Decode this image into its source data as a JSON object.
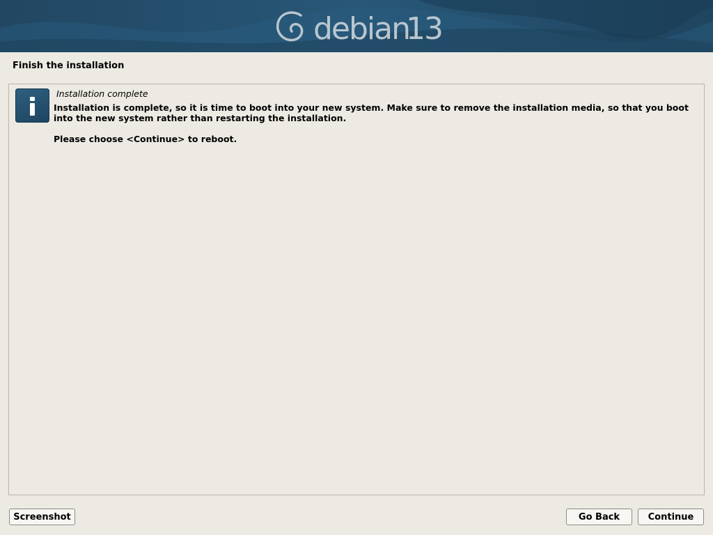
{
  "banner": {
    "logo_text": "debian",
    "version": "13"
  },
  "page": {
    "title": "Finish the installation"
  },
  "question": {
    "title": "Installation complete",
    "paragraphs": [
      "Installation is complete, so it is time to boot into your new system. Make sure to remove the installation media, so that you boot into the new system rather than restarting the installation.",
      "Please choose <Continue> to reboot."
    ],
    "icon": "info-icon"
  },
  "buttons": {
    "screenshot": "Screenshot",
    "go_back": "Go Back",
    "continue": "Continue"
  },
  "colors": {
    "banner_bg": "#244a66",
    "page_bg": "#edeae3",
    "icon_bg": "#2a5878"
  }
}
